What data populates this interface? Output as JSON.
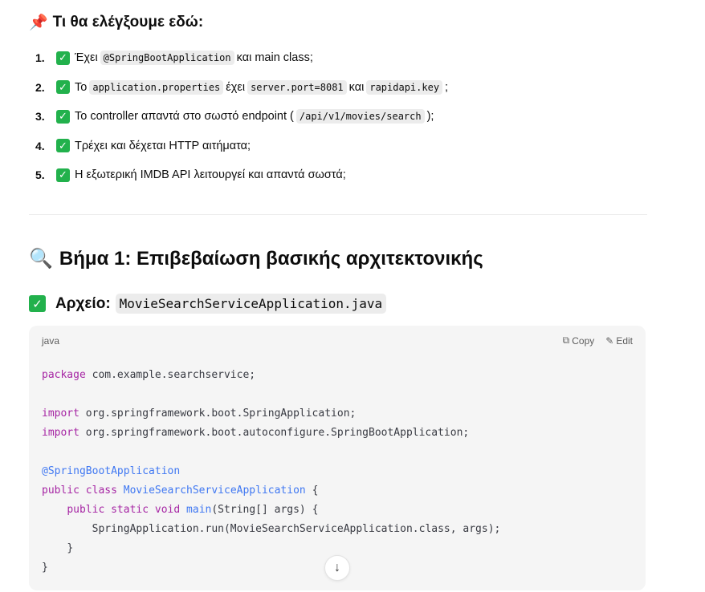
{
  "section_checks": {
    "title": "Τι θα ελέγξουμε εδώ:",
    "pin_icon": "📌",
    "items": [
      {
        "num": "1.",
        "parts": [
          "Έχει ",
          "@SpringBootApplication",
          " και main class;"
        ]
      },
      {
        "num": "2.",
        "parts": [
          "Το ",
          "application.properties",
          " έχει ",
          "server.port=8081",
          " και ",
          "rapidapi.key",
          ";"
        ]
      },
      {
        "num": "3.",
        "parts": [
          "Το controller απαντά στο σωστό endpoint (",
          "/api/v1/movies/search",
          ");"
        ]
      },
      {
        "num": "4.",
        "parts": [
          "Τρέχει και δέχεται HTTP αιτήματα;"
        ]
      },
      {
        "num": "5.",
        "parts": [
          "Η εξωτερική IMDB API λειτουργεί και απαντά σωστά;"
        ]
      }
    ]
  },
  "step1": {
    "icon": "🔍",
    "title": "Βήμα 1: Επιβεβαίωση βασικής αρχιτεκτονικής",
    "file_label": "Αρχείο:",
    "file_name": "MovieSearchServiceApplication.java"
  },
  "codeblock": {
    "lang": "java",
    "copy_label": "Copy",
    "edit_label": "Edit",
    "lines": {
      "l1a": "package",
      "l1b": " com.example.searchservice;",
      "l3a": "import",
      "l3b": " org.springframework.boot.SpringApplication;",
      "l4a": "import",
      "l4b": " org.springframework.boot.autoconfigure.SpringBootApplication;",
      "l6": "@SpringBootApplication",
      "l7a": "public",
      "l7b": "class",
      "l7c": "MovieSearchServiceApplication",
      "l7d": " {",
      "l8a": "public",
      "l8b": "static",
      "l8c": "void",
      "l8d": "main",
      "l8e": "(String[] args) {",
      "l9": "SpringApplication.run(MovieSearchServiceApplication.class, args);",
      "l10": "}",
      "l11": "}"
    }
  },
  "colors": {
    "check_green": "#22b14c",
    "keyword": "#a626a4",
    "annotation": "#4078f2"
  }
}
